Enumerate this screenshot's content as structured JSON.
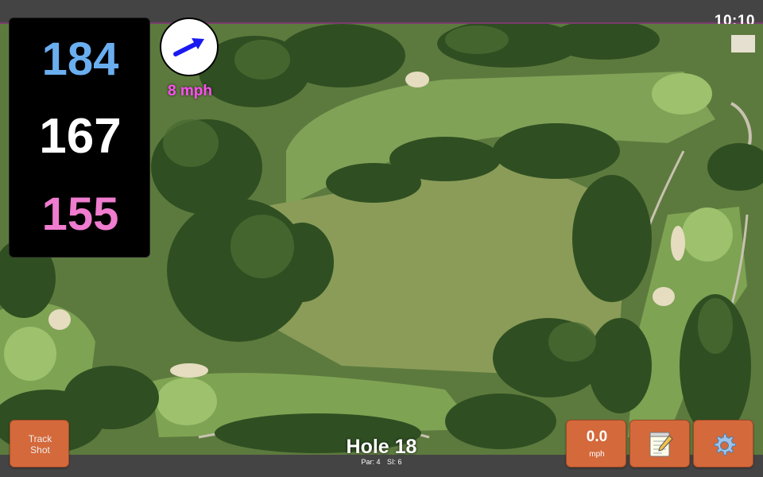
{
  "status": {
    "time": "10:10"
  },
  "yardages": {
    "back": "184",
    "middle": "167",
    "front": "155",
    "back_color": "#6aaef0",
    "middle_color": "#ffffff",
    "front_color": "#f07ccf"
  },
  "wind": {
    "speed": "8 mph",
    "arrow_color": "#1a1af0",
    "text_color": "#ff4ff2"
  },
  "hole": {
    "title": "Hole 18",
    "par": "Par: 4",
    "si": "SI: 6"
  },
  "buttons": {
    "track_line1": "Track",
    "track_line2": "Shot",
    "speed_value": "0.0",
    "speed_unit": "mph",
    "notes_icon": "notepad-icon",
    "settings_icon": "gear-icon"
  },
  "colors": {
    "button_bg": "#d4693b",
    "panel_bg": "#000000"
  }
}
